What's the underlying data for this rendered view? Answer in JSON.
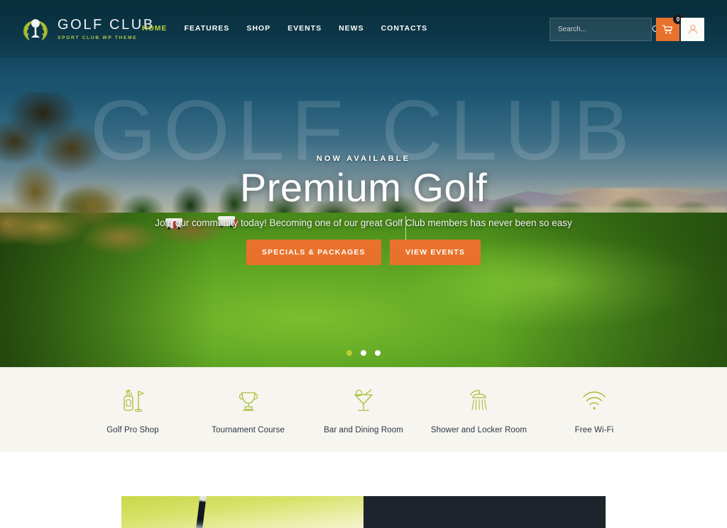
{
  "header": {
    "logo": {
      "icon": "golf-tee-laurel-wreath",
      "title": "GOLF CLUB",
      "subtitle": "SPORT CLUB WP THEME"
    },
    "nav": [
      {
        "label": "HOME",
        "active": true
      },
      {
        "label": "FEATURES",
        "active": false
      },
      {
        "label": "SHOP",
        "active": false
      },
      {
        "label": "EVENTS",
        "active": false
      },
      {
        "label": "NEWS",
        "active": false
      },
      {
        "label": "CONTACTS",
        "active": false
      }
    ],
    "search": {
      "placeholder": "Search...",
      "value": "",
      "icon": "search-icon"
    },
    "cart": {
      "icon": "shopping-cart-icon",
      "count": "0"
    },
    "account": {
      "icon": "user-account-icon"
    }
  },
  "hero": {
    "watermark": "GOLF CLUB",
    "eyebrow": "NOW AVAILABLE",
    "title": "Premium Golf",
    "subtitle": "Join our community today! Becoming one of our great Golf Club members has never been so easy",
    "buttons": [
      {
        "label": "SPECIALS & PACKAGES"
      },
      {
        "label": "VIEW EVENTS"
      }
    ],
    "slider_dots": [
      {
        "active": true
      },
      {
        "active": false
      },
      {
        "active": false
      }
    ]
  },
  "features": [
    {
      "icon": "golf-bag-icon",
      "label": "Golf Pro Shop"
    },
    {
      "icon": "trophy-icon",
      "label": "Tournament Course"
    },
    {
      "icon": "cocktail-glass-icon",
      "label": "Bar and Dining Room"
    },
    {
      "icon": "shower-head-icon",
      "label": "Shower and Locker Room"
    },
    {
      "icon": "wifi-icon",
      "label": "Free Wi-Fi"
    }
  ],
  "colors": {
    "accent_orange": "#e8722c",
    "accent_green": "#b9d134",
    "header_dark": "#0b3547",
    "band_bg": "#f6f5f0",
    "panel_dark": "#1e242c"
  }
}
